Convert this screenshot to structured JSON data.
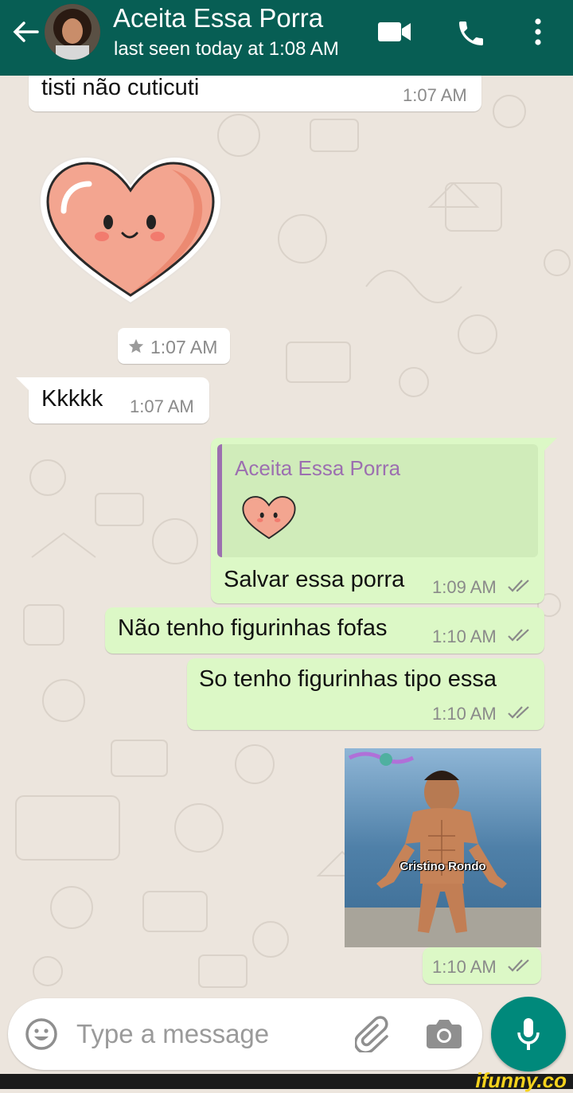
{
  "header": {
    "title": "Aceita Essa Porra",
    "subtitle": "last seen today at 1:08 AM"
  },
  "messages": {
    "m1": {
      "text": "tisti não cuticuti",
      "time": "1:07 AM"
    },
    "m2_sticker": {
      "time": "1:07 AM",
      "starred": true
    },
    "m3": {
      "text": "Kkkkk",
      "time": "1:07 AM"
    },
    "m4": {
      "quoted_author": "Aceita Essa Porra",
      "text": "Salvar essa porra",
      "time": "1:09 AM"
    },
    "m5": {
      "text": "Não tenho figurinhas fofas",
      "time": "1:10 AM"
    },
    "m6": {
      "text": "So tenho figurinhas tipo essa",
      "time": "1:10 AM"
    },
    "m7_sticker": {
      "caption": "Cristino Rondo",
      "time": "1:10 AM"
    }
  },
  "composer": {
    "placeholder": "Type a message"
  },
  "watermark": "ifunny.co",
  "colors": {
    "header": "#075e54",
    "outgoing_bubble": "#dcf8c6",
    "incoming_bubble": "#ffffff",
    "mic_button": "#00897b",
    "quote_author": "#9c6fb0",
    "read_ticks": "#8a8a8a"
  },
  "icons": {
    "back": "back-arrow-icon",
    "video": "video-call-icon",
    "call": "phone-icon",
    "menu": "more-vert-icon",
    "emoji": "emoji-icon",
    "attach": "paperclip-icon",
    "camera": "camera-icon",
    "mic": "mic-icon",
    "star": "star-icon",
    "ticks": "double-check-icon"
  }
}
